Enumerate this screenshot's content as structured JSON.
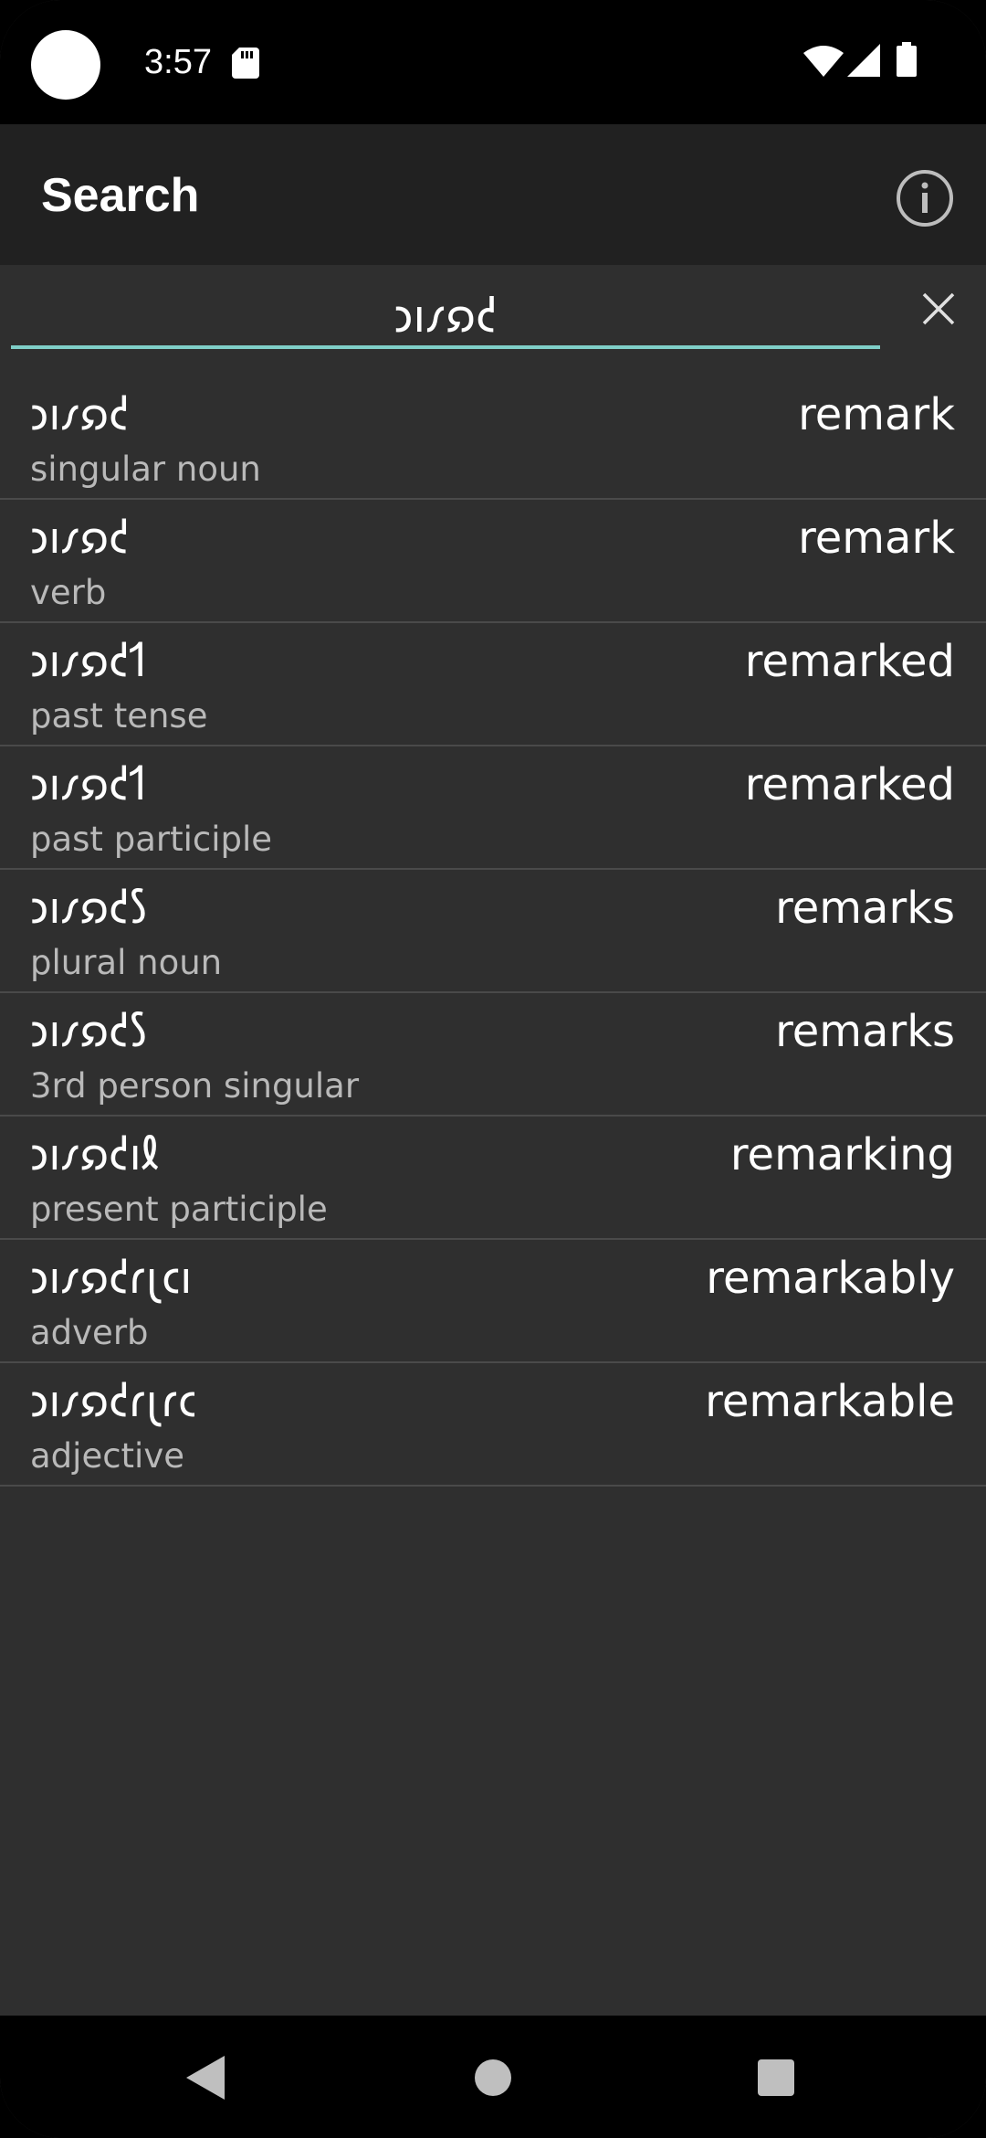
{
  "status_bar": {
    "time": "3:57",
    "icons": [
      "camera-dot",
      "sd-card-icon",
      "wifi-icon",
      "signal-icon",
      "battery-icon"
    ]
  },
  "app_bar": {
    "title": "Search",
    "info_icon": "info-icon"
  },
  "search": {
    "value": "𐑮𐑦𐑥𐑸𐑒",
    "clear_icon": "close-icon"
  },
  "results": [
    {
      "shavian": "𐑮𐑦𐑥𐑸𐑒",
      "latin": "remark",
      "pos": "singular noun"
    },
    {
      "shavian": "𐑮𐑦𐑥𐑸𐑒",
      "latin": "remark",
      "pos": "verb"
    },
    {
      "shavian": "𐑮𐑦𐑥𐑸𐑒𐑑",
      "latin": "remarked",
      "pos": "past tense"
    },
    {
      "shavian": "𐑮𐑦𐑥𐑸𐑒𐑑",
      "latin": "remarked",
      "pos": "past participle"
    },
    {
      "shavian": "𐑮𐑦𐑥𐑸𐑒𐑕",
      "latin": "remarks",
      "pos": "plural noun"
    },
    {
      "shavian": "𐑮𐑦𐑥𐑸𐑒𐑕",
      "latin": "remarks",
      "pos": "3rd person singular"
    },
    {
      "shavian": "𐑮𐑦𐑥𐑸𐑒𐑦𐑙",
      "latin": "remarking",
      "pos": "present participle"
    },
    {
      "shavian": "𐑮𐑦𐑥𐑸𐑒𐑩𐑚𐑤𐑦",
      "latin": "remarkably",
      "pos": "adverb"
    },
    {
      "shavian": "𐑮𐑦𐑥𐑸𐑒𐑩𐑚𐑩𐑤",
      "latin": "remarkable",
      "pos": "adjective"
    }
  ],
  "colors": {
    "background": "#2f2f2f",
    "app_bar": "#212121",
    "accent": "#7fcfc8",
    "divider": "#4a4a4a",
    "secondary_text": "#b9b9b9"
  }
}
